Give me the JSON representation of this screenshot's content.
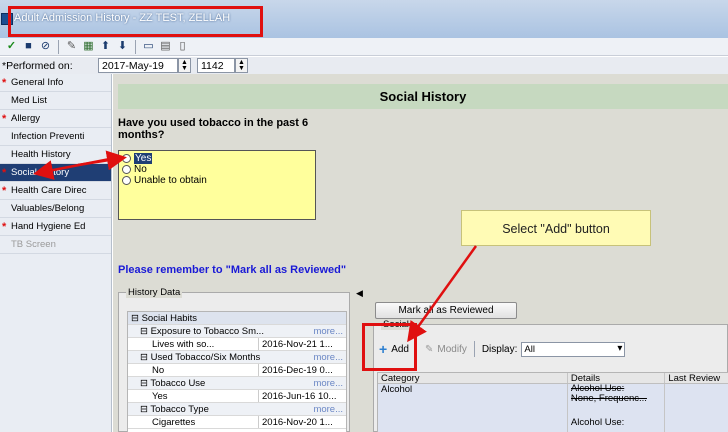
{
  "window": {
    "title": "Adult Admission History - ZZ TEST, ZELLAH"
  },
  "toolbar": {
    "icons": [
      "checkmark-icon",
      "save-icon",
      "cancel-icon",
      "edit-icon",
      "calculator-icon",
      "up-arrow-icon",
      "down-arrow-icon",
      "monitor-icon",
      "image-icon",
      "document-icon"
    ]
  },
  "performed": {
    "label": "*Performed on:",
    "date": "2017-May-19",
    "time": "1142"
  },
  "sidebar": {
    "items": [
      {
        "label": "General Info",
        "required": "*"
      },
      {
        "label": "Med List",
        "required": ""
      },
      {
        "label": "Allergy",
        "required": "*"
      },
      {
        "label": "Infection Preventi",
        "required": ""
      },
      {
        "label": "Health History",
        "required": ""
      },
      {
        "label": "Social History",
        "required": "*"
      },
      {
        "label": "Health Care Direc",
        "required": "*"
      },
      {
        "label": "Valuables/Belong",
        "required": ""
      },
      {
        "label": "Hand Hygiene Ed",
        "required": "*"
      },
      {
        "label": "TB Screen",
        "required": ""
      }
    ]
  },
  "content": {
    "header": "Social History",
    "question": "Have you used tobacco in the past 6 months?",
    "options": [
      "Yes",
      "No",
      "Unable to obtain"
    ],
    "selected_option": "Yes",
    "reminder": "Please remember to \"Mark all as Reviewed\"",
    "callout": "Select \"Add\" button"
  },
  "history": {
    "title": "History Data",
    "rows": [
      {
        "label": "⊟ Social Habits",
        "more": "",
        "value": "",
        "kind": "hdr"
      },
      {
        "label": "⊟ Exposure to Tobacco Sm...",
        "more": "more...",
        "value": "",
        "kind": "sub"
      },
      {
        "label": "Lives with so...",
        "more": "",
        "value": "2016-Nov-21 1...",
        "kind": "leaf"
      },
      {
        "label": "⊟ Used Tobacco/Six Months",
        "more": "more...",
        "value": "",
        "kind": "sub"
      },
      {
        "label": "No",
        "more": "",
        "value": "2016-Dec-19 0...",
        "kind": "leaf"
      },
      {
        "label": "⊟ Tobacco Use",
        "more": "more...",
        "value": "",
        "kind": "sub"
      },
      {
        "label": "Yes",
        "more": "",
        "value": "2016-Jun-16 10...",
        "kind": "leaf"
      },
      {
        "label": "⊟ Tobacco Type",
        "more": "more...",
        "value": "",
        "kind": "sub"
      },
      {
        "label": "Cigarettes",
        "more": "",
        "value": "2016-Nov-20 1...",
        "kind": "leaf"
      }
    ]
  },
  "social": {
    "mark_all_label": "Mark all as Reviewed",
    "title": "Social",
    "add_label": "Add",
    "modify_label": "Modify",
    "display_label": "Display:",
    "display_value": "All",
    "columns": [
      "Category",
      "Details",
      "Last Review"
    ],
    "row": {
      "category": "Alcohol",
      "details1": "Alcohol Use:",
      "details2": "None, Frequenc...",
      "details3": "Alcohol Use:"
    }
  },
  "colors": {
    "accent_red": "#e01010",
    "nav_active": "#1f3e74",
    "reminder_blue": "#1a1ad6",
    "options_yellow": "#ffff9c"
  }
}
